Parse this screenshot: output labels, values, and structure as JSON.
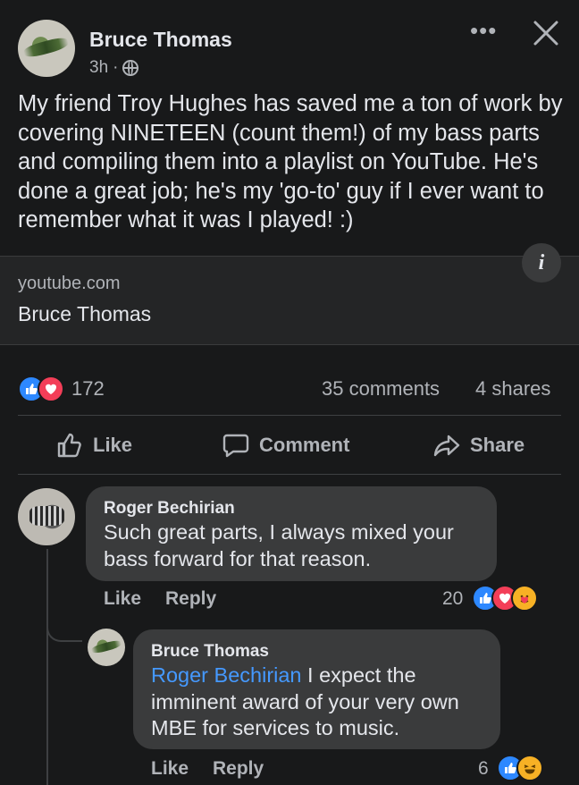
{
  "post": {
    "author": "Bruce Thomas",
    "time": "3h",
    "separator": "·",
    "privacy_icon": "globe-icon",
    "text": "My friend Troy Hughes has saved me a ton of work by covering NINETEEN (count them!) of my bass parts and compiling them into a playlist on YouTube. He's done a great job; he's my 'go-to' guy if I ever want to remember what it was I played! :)",
    "more_icon": "more-horizontal-icon",
    "close_icon": "close-icon"
  },
  "link_preview": {
    "domain": "youtube.com",
    "title": "Bruce Thomas",
    "info_label": "i"
  },
  "stats": {
    "reactions": [
      "like",
      "love"
    ],
    "reaction_count": "172",
    "comments": "35 comments",
    "shares": "4 shares"
  },
  "actions": {
    "like": "Like",
    "comment": "Comment",
    "share": "Share"
  },
  "comments": [
    {
      "author": "Roger Bechirian",
      "text": "Such great parts, I always mixed your bass forward for that reason.",
      "like": "Like",
      "reply": "Reply",
      "reaction_count": "20",
      "reactions": [
        "like",
        "love",
        "care"
      ]
    },
    {
      "author": "Bruce Thomas",
      "mention": "Roger Bechirian",
      "text": " I expect the imminent award of your very own MBE for services to music.",
      "like": "Like",
      "reply": "Reply",
      "reaction_count": "6",
      "reactions": [
        "like",
        "haha"
      ]
    }
  ],
  "colors": {
    "background": "#18191a",
    "card": "#242526",
    "bubble": "#3a3b3c",
    "text": "#e4e6eb",
    "secondary": "#b0b3b8",
    "link": "#4599ff",
    "like_blue": "#2d88ff",
    "love_red": "#f33e58",
    "emoji_yellow": "#f7b125"
  }
}
